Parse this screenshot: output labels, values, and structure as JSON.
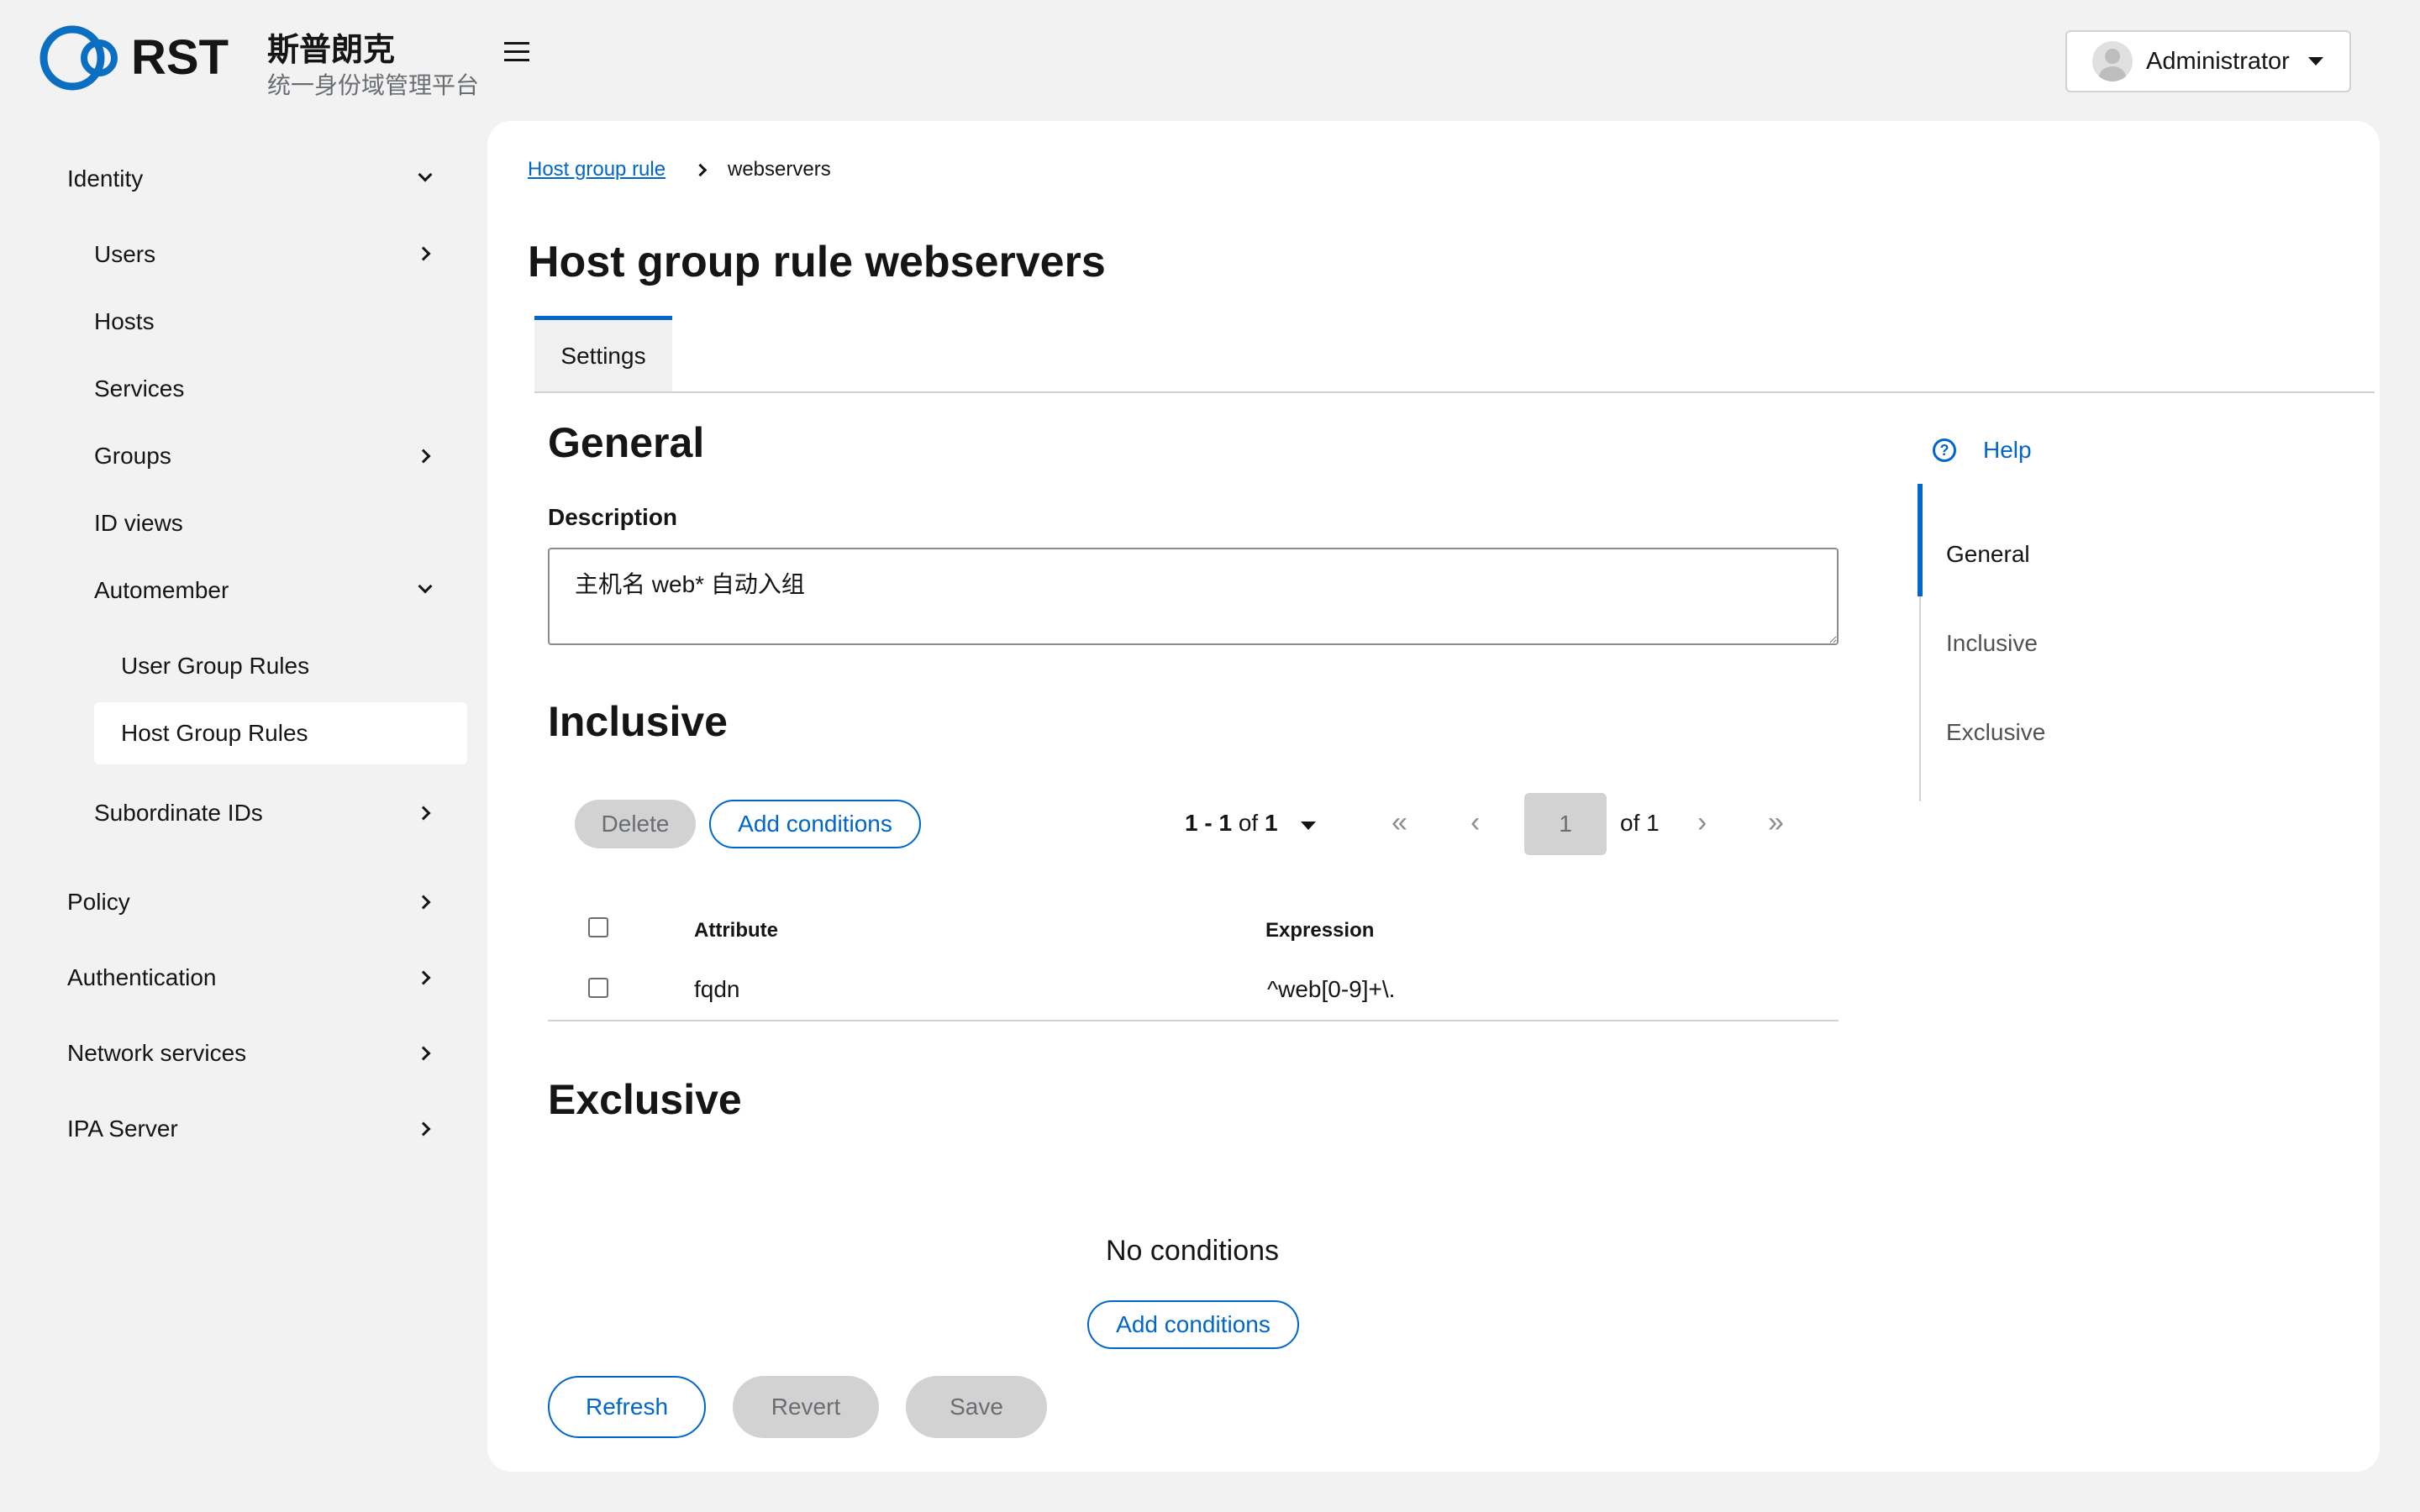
{
  "header": {
    "logo_text": "RST",
    "brand_name": "斯普朗克",
    "brand_subtitle": "统一身份域管理平台",
    "user_name": "Administrator"
  },
  "sidebar": {
    "identity": "Identity",
    "users": "Users",
    "hosts": "Hosts",
    "services": "Services",
    "groups": "Groups",
    "id_views": "ID views",
    "automember": "Automember",
    "user_group_rules": "User Group Rules",
    "host_group_rules": "Host Group Rules",
    "subordinate_ids": "Subordinate IDs",
    "policy": "Policy",
    "authentication": "Authentication",
    "network_services": "Network services",
    "ipa_server": "IPA Server"
  },
  "breadcrumb": {
    "parent": "Host group rule",
    "current": "webservers"
  },
  "page": {
    "title": "Host group rule webservers",
    "tab_settings": "Settings"
  },
  "general": {
    "title": "General",
    "description_label": "Description",
    "description_value": "主机名 web* 自动入组"
  },
  "inclusive": {
    "title": "Inclusive",
    "delete_label": "Delete",
    "add_conditions_label": "Add conditions",
    "pager": {
      "range": "1 - 1",
      "of_word": "of",
      "total": "1",
      "page": "1",
      "of_pages": "of 1"
    },
    "columns": [
      "Attribute",
      "Expression"
    ],
    "rows": [
      {
        "attribute": "fqdn",
        "expression": "^web[0-9]+\\."
      }
    ]
  },
  "exclusive": {
    "title": "Exclusive",
    "empty_text": "No conditions",
    "add_conditions_label": "Add conditions"
  },
  "footer": {
    "refresh": "Refresh",
    "revert": "Revert",
    "save": "Save"
  },
  "jump_links": {
    "help": "Help",
    "items": [
      "General",
      "Inclusive",
      "Exclusive"
    ]
  },
  "colors": {
    "accent": "#0066cc",
    "logo": "#0a6fc2",
    "background": "#f2f2f2",
    "disabled": "#d2d2d2"
  }
}
